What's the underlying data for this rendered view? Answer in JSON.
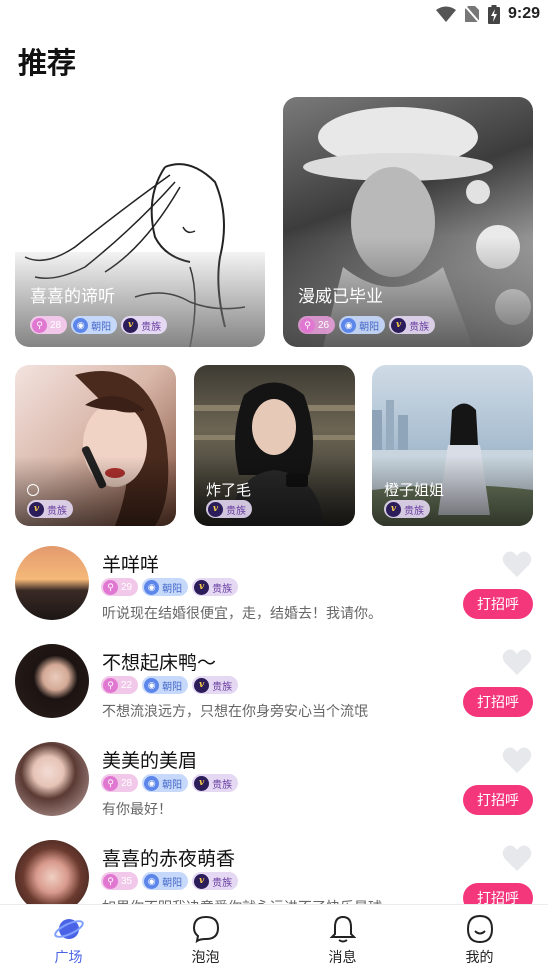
{
  "status_bar": {
    "time": "9:29"
  },
  "page": {
    "title": "推荐"
  },
  "featured": [
    {
      "name": "喜喜的谛听",
      "age": "28",
      "location": "朝阳",
      "vip": "贵族"
    },
    {
      "name": "漫威已毕业",
      "age": "26",
      "location": "朝阳",
      "vip": "贵族"
    }
  ],
  "spotlight": [
    {
      "name": "",
      "vip": "贵族"
    },
    {
      "name": "炸了毛",
      "vip": "贵族"
    },
    {
      "name": "橙子姐姐",
      "vip": "贵族"
    }
  ],
  "users": [
    {
      "name": "羊咩咩",
      "age": "29",
      "location": "朝阳",
      "vip": "贵族",
      "bio": "听说现在结婚很便宜，走，结婚去！我请你。",
      "action": "打招呼"
    },
    {
      "name": "不想起床鸭～",
      "age": "22",
      "location": "朝阳",
      "vip": "贵族",
      "bio": "不想流浪远方，只想在你身旁安心当个流氓",
      "action": "打招呼"
    },
    {
      "name": "美美的美眉",
      "age": "28",
      "location": "朝阳",
      "vip": "贵族",
      "bio": "有你最好！",
      "action": "打招呼"
    },
    {
      "name": "喜喜的赤夜萌香",
      "age": "35",
      "location": "朝阳",
      "vip": "贵族",
      "bio": "如果你不明我决意爱你就永远进不了快乐星球",
      "action": "打招呼"
    }
  ],
  "tabs": [
    {
      "label": "广场",
      "icon": "planet-icon",
      "active": true
    },
    {
      "label": "泡泡",
      "icon": "bubble-icon",
      "active": false
    },
    {
      "label": "消息",
      "icon": "bell-icon",
      "active": false
    },
    {
      "label": "我的",
      "icon": "smile-icon",
      "active": false
    }
  ],
  "colors": {
    "accent": "#f4367a",
    "tab_active": "#4a63e6",
    "age_tag": "#e078d2",
    "location_tag": "#5d86ea",
    "vip_tag": "#2b1c5a"
  }
}
